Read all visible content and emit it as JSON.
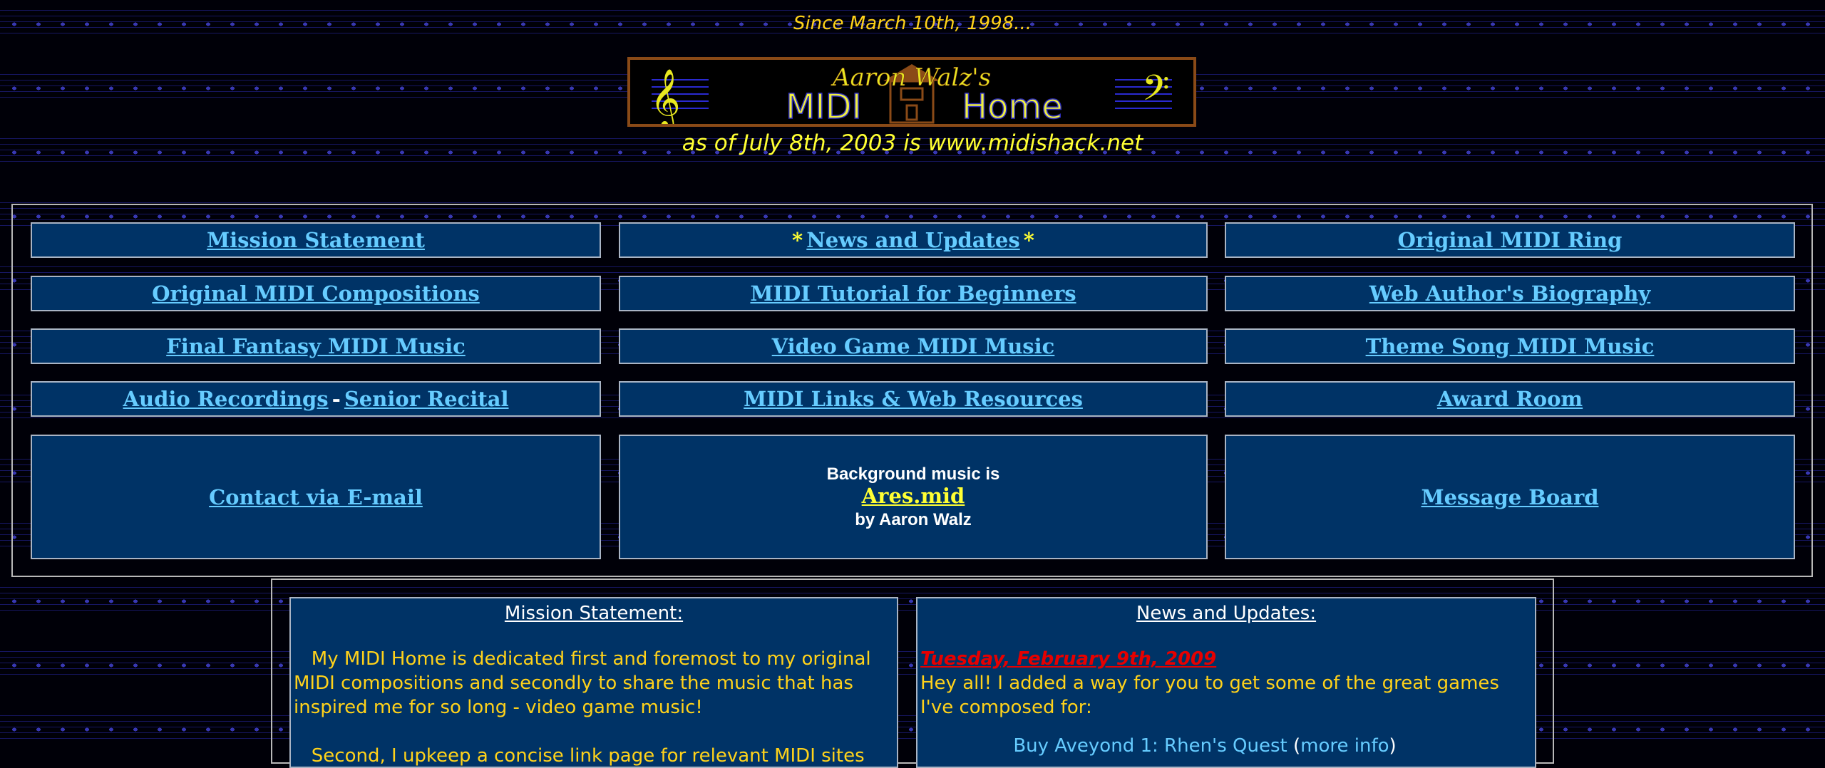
{
  "header": {
    "since": "Since March 10th, 1998...",
    "banner": {
      "top_text": "Aaron Walz's",
      "left_word": "MIDI",
      "right_word": "Home"
    },
    "as_of": "as of July 8th, 2003 is www.midishack.net"
  },
  "nav": {
    "mission_statement": "Mission Statement",
    "star": "*",
    "news_updates": "News and Updates",
    "original_midi_ring": "Original MIDI Ring",
    "original_compositions": "Original MIDI Compositions",
    "tutorial": "MIDI Tutorial for Beginners",
    "biography": "Web Author's Biography",
    "final_fantasy": "Final Fantasy MIDI Music",
    "video_game": "Video Game MIDI Music",
    "theme_song": "Theme Song MIDI Music",
    "audio_recordings": "Audio Recordings",
    "dash": "-",
    "senior_recital": "Senior Recital",
    "links_resources": "MIDI Links & Web Resources",
    "award_room": "Award Room",
    "contact": "Contact via E-mail",
    "message_board": "Message Board",
    "bgmusic_line1": "Background music is",
    "bgmusic_file": "Ares.mid",
    "bgmusic_line3": "by Aaron Walz"
  },
  "mission": {
    "title": "Mission Statement:",
    "para1": "   My MIDI Home is dedicated first and foremost to my original MIDI compositions and secondly to share the music that has inspired me for so long - video game music!",
    "para2": "   Second, I upkeep a concise link page for relevant MIDI sites"
  },
  "news": {
    "title": "News and Updates:",
    "date": "Tuesday, February 9th, 2009",
    "body": "Hey all!  I added a way for you to get some of the great games I've composed for:",
    "game_link": "Buy Aveyond 1: Rhen's Quest",
    "more_info_open": "(",
    "more_info": "more info",
    "more_info_close": ")"
  },
  "colors": {
    "background": "#000008",
    "staff_lines": "#2828aa",
    "cell_bg": "#003366",
    "link": "#66ccff",
    "gold_text": "#ffd21a",
    "yellow": "#ffff33",
    "date_red": "#e60000",
    "banner_border": "#8a4a17"
  }
}
